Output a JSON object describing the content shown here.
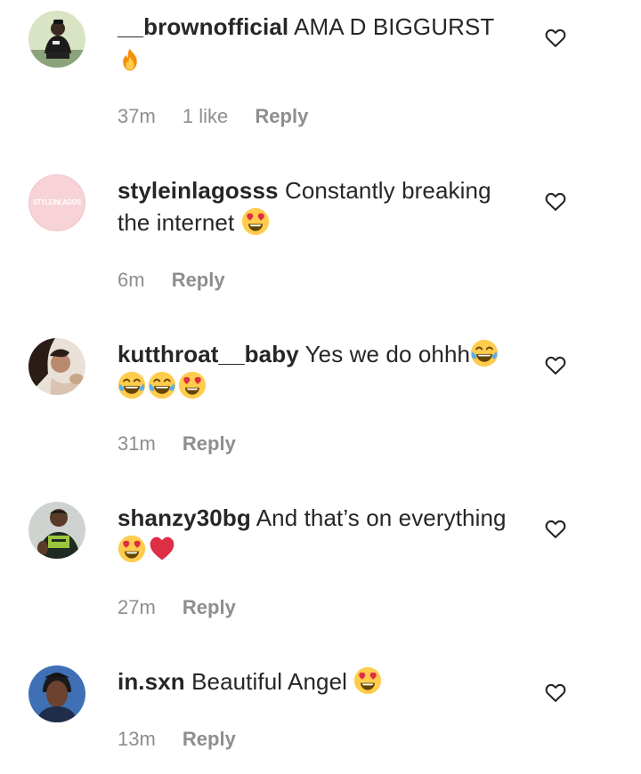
{
  "comments": [
    {
      "username": "__brownofficial",
      "text": "AMA D BIGGURST",
      "emojis": [
        "fire"
      ],
      "time": "37m",
      "likes": "1 like",
      "reply": "Reply"
    },
    {
      "username": "styleinlagosss",
      "text": "Constantly breaking the internet",
      "emojis": [
        "heart-eyes"
      ],
      "avatar_text": "STYLEINLAGOS",
      "time": "6m",
      "likes": "",
      "reply": "Reply"
    },
    {
      "username": "kutthroat__baby",
      "text": "Yes we do ohhh",
      "emojis": [
        "joy",
        "joy",
        "joy",
        "heart-eyes"
      ],
      "time": "31m",
      "likes": "",
      "reply": "Reply"
    },
    {
      "username": "shanzy30bg",
      "text": "And that’s on everything",
      "emojis": [
        "heart-eyes",
        "red-heart"
      ],
      "time": "27m",
      "likes": "",
      "reply": "Reply"
    },
    {
      "username": "in.sxn",
      "text": "Beautiful Angel",
      "emojis": [
        "heart-eyes"
      ],
      "time": "13m",
      "likes": "",
      "reply": "Reply"
    }
  ],
  "colors": {
    "text": "#262626",
    "meta": "#8e8e8e",
    "styleinlagos_bg": "#f7d3d8"
  }
}
